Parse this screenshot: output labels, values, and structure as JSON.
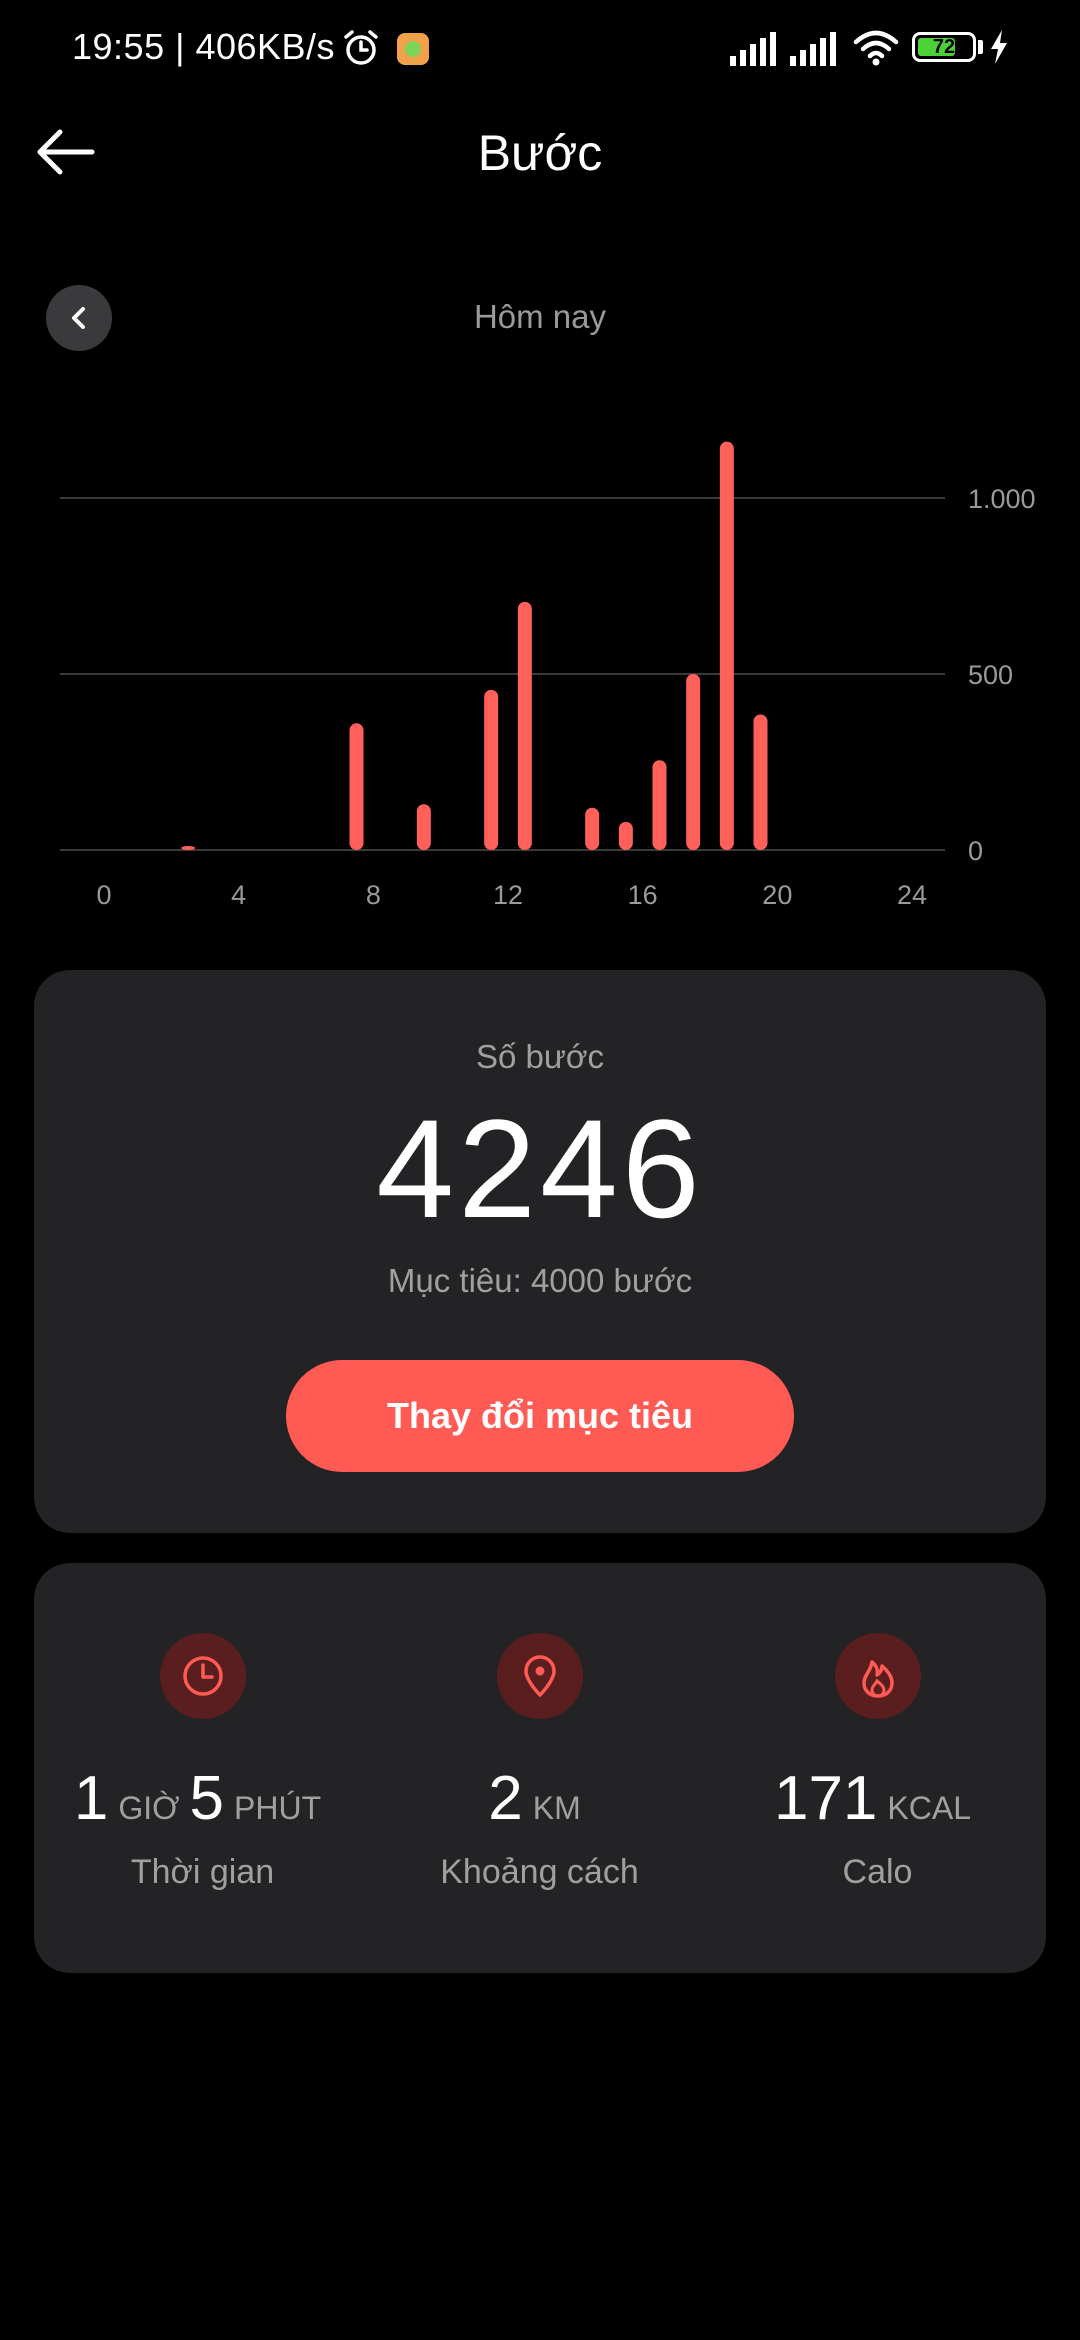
{
  "status_bar": {
    "text": "19:55 | 406KB/s",
    "battery_level": "72",
    "battery_fill": 0.72,
    "icons": [
      "alarm-icon",
      "app-notification-icon",
      "signal-icon",
      "signal-icon",
      "wifi-icon",
      "battery-icon",
      "charging-icon"
    ]
  },
  "header": {
    "title": "Bước",
    "back_icon": "arrow-left-icon"
  },
  "date_nav": {
    "label": "Hôm nay",
    "prev_icon": "chevron-left-icon"
  },
  "colors": {
    "accent": "#ff5b54",
    "bar": "#ff615a",
    "card": "#232325",
    "icon_bg": "#5a1e1e"
  },
  "chart_data": {
    "type": "bar",
    "x_ticks": [
      "0",
      "4",
      "8",
      "12",
      "16",
      "20",
      "24"
    ],
    "y_ticks": [
      "0",
      "500",
      "1.000"
    ],
    "ylim": [
      0,
      1200
    ],
    "xlim": [
      0,
      24
    ],
    "grid": true,
    "bars": [
      {
        "hour": 2,
        "value": 10
      },
      {
        "hour": 7,
        "value": 360
      },
      {
        "hour": 9,
        "value": 130
      },
      {
        "hour": 11,
        "value": 455
      },
      {
        "hour": 12,
        "value": 705
      },
      {
        "hour": 14,
        "value": 120
      },
      {
        "hour": 15,
        "value": 80
      },
      {
        "hour": 16,
        "value": 255
      },
      {
        "hour": 17,
        "value": 500
      },
      {
        "hour": 18,
        "value": 1160
      },
      {
        "hour": 19,
        "value": 385
      }
    ]
  },
  "steps_card": {
    "label": "Số bước",
    "value": "4246",
    "goal": "Mục tiêu: 4000 bước",
    "button": "Thay đổi mục tiêu"
  },
  "metrics": {
    "time": {
      "icon": "clock-icon",
      "hours": "1",
      "hours_unit": "GIỜ",
      "minutes": "5",
      "minutes_unit": "PHÚT",
      "label": "Thời gian"
    },
    "distance": {
      "icon": "location-pin-icon",
      "value": "2",
      "unit": "KM",
      "label": "Khoảng cách"
    },
    "calories": {
      "icon": "flame-icon",
      "value": "171",
      "unit": "KCAL",
      "label": "Calo"
    }
  }
}
